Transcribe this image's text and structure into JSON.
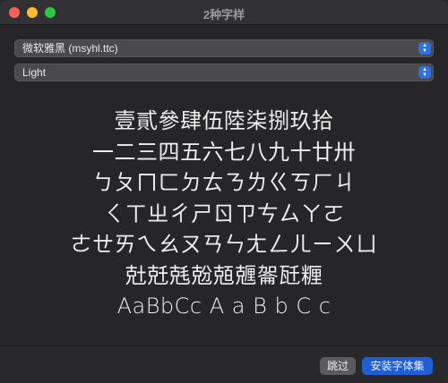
{
  "window": {
    "title": "2种字样"
  },
  "font_select": {
    "value": "微软雅黑 (msyhl.ttc)"
  },
  "weight_select": {
    "value": "Light"
  },
  "preview": {
    "lines": [
      "壹貳參肆伍陸柒捌玖拾",
      "一二三四五六七八九十廿卅",
      "ㄅㄆㄇㄈㄉㄊㄋㄌㄍㄎㄏㄐ",
      "ㄑㄒㄓㄔㄕㄖㄗㄘㄙㄚㄛ",
      "ㄜㄝㄞㄟㄠㄡㄢㄣㄤㄥㄦㄧㄨㄩ",
      "兙兛兞兝兡兣嗧瓩糎",
      "AaBbCc A a B b C c"
    ]
  },
  "footer": {
    "skip_label": "跳过",
    "install_label": "安装字体集"
  },
  "colors": {
    "accent": "#1f5fd6",
    "close": "#fe5f57",
    "minimize": "#febc2e",
    "maximize": "#28c840"
  }
}
